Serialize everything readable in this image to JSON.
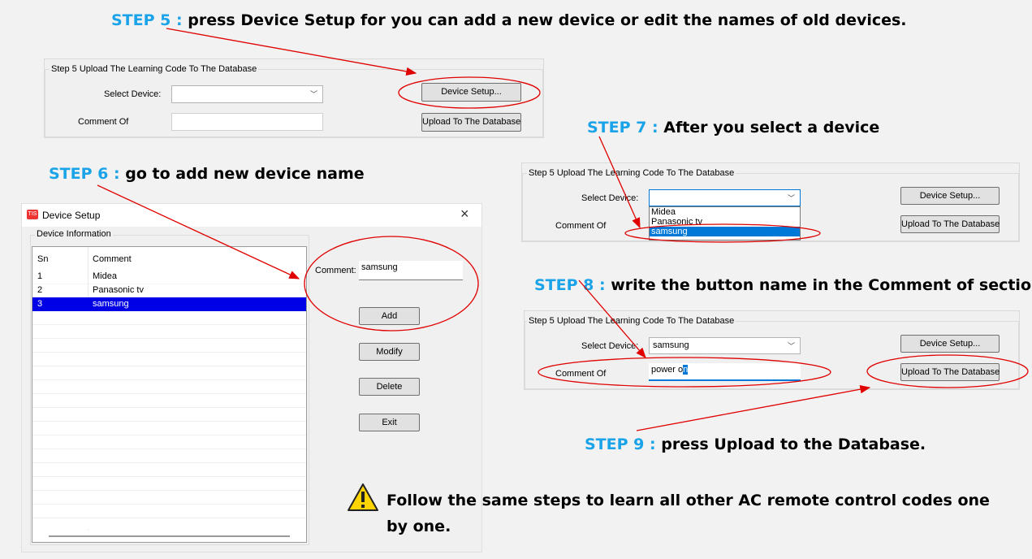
{
  "steps": {
    "s5": {
      "num": "STEP 5 :",
      "text": "press Device Setup for you can add a new device or edit the names of old devices."
    },
    "s6": {
      "num": "STEP 6 :",
      "text": "go to add new device name"
    },
    "s7": {
      "num": "STEP 7 :",
      "text": "After you select a device"
    },
    "s8": {
      "num": "STEP 8 :",
      "text": "write the button name in the Comment of section"
    },
    "s9": {
      "num": "STEP 9 :",
      "text": "press Upload to the Database."
    }
  },
  "note": {
    "line1": "Follow the same steps to learn all other AC remote control codes one",
    "line2": "by one."
  },
  "upload_group": {
    "title": "Step 5 Upload The Learning Code To The Database",
    "select_label": "Select Device:",
    "comment_label": "Comment Of",
    "device_setup_btn": "Device Setup...",
    "upload_btn": "Upload To The Database"
  },
  "panel7": {
    "dropdown_options": [
      "Midea",
      "Panasonic tv",
      "samsung"
    ],
    "selected": "samsung"
  },
  "panel8": {
    "selected_device": "samsung",
    "comment_value_pre": "power o",
    "comment_value_sel": "n"
  },
  "dialog": {
    "title": "Device Setup",
    "close": "×",
    "logo": "TIS",
    "group_title": "Device Information",
    "columns": [
      "Sn",
      "Comment"
    ],
    "rows": [
      {
        "sn": "1",
        "comment": "Midea"
      },
      {
        "sn": "2",
        "comment": "Panasonic tv"
      },
      {
        "sn": "3",
        "comment": "samsung"
      }
    ],
    "comment_label": "Comment:",
    "comment_value": "samsung",
    "buttons": {
      "add": "Add",
      "modify": "Modify",
      "delete": "Delete",
      "exit": "Exit"
    }
  },
  "colors": {
    "step_blue": "#1aa3e8",
    "annotation_red": "#e00000",
    "selection_blue": "#0000e6"
  }
}
